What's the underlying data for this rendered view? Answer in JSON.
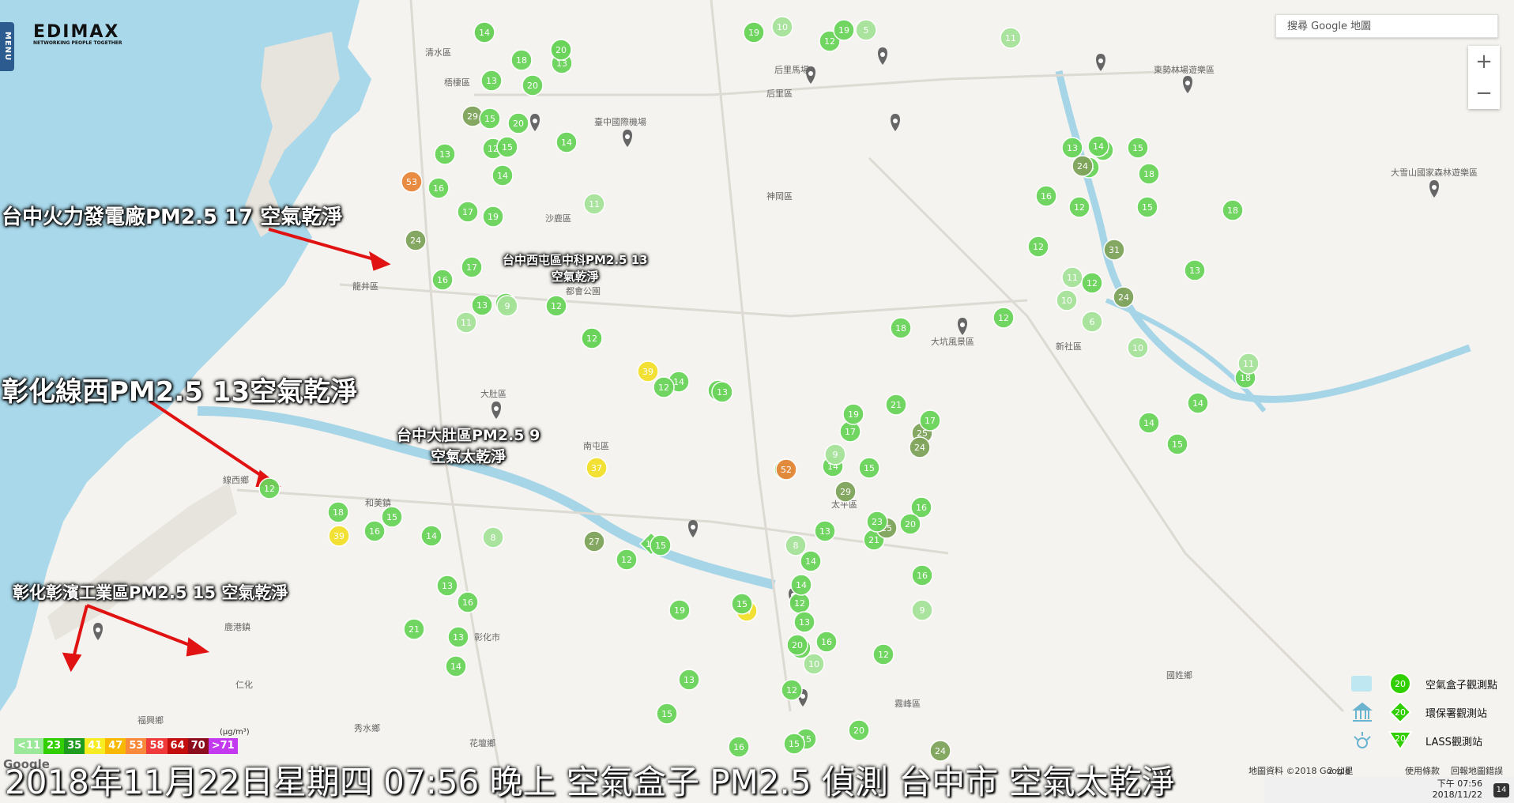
{
  "header": {
    "menu_label": "MENU",
    "brand": "EDIMAX",
    "tagline": "NETWORKING PEOPLE TOGETHER",
    "search_placeholder": "搜尋 Google 地圖"
  },
  "zoom": {
    "in_label": "+",
    "out_label": "−"
  },
  "callouts": [
    {
      "text": "台中火力發電廠PM2.5 17 空氣乾淨",
      "size": "large"
    },
    {
      "text": "台中西屯區中科PM2.5 13",
      "text2": "空氣乾淨",
      "size": "small"
    },
    {
      "text": "彰化線西PM2.5 13空氣乾淨",
      "size": "xl"
    },
    {
      "text": "台中大肚區PM2.5 9",
      "text2": "空氣太乾淨",
      "size": "medium"
    },
    {
      "text": "彰化彰濱工業區PM2.5 15 空氣乾淨",
      "size": "medium"
    }
  ],
  "place_names": [
    "清水區",
    "沙鹿區",
    "龍井區",
    "大肚區",
    "梧棲區",
    "臺中國際機場",
    "后里區",
    "后里馬場",
    "東勢林場遊樂區",
    "大雪山國家森林遊樂區",
    "大坑風景區",
    "新社區",
    "和美鎮",
    "線西鄉",
    "鹿港鎮",
    "福興鄉",
    "秀水鄉",
    "花壇鄉",
    "彰化市",
    "霧峰區",
    "太平區",
    "南屯區",
    "國姓鄉",
    "都會公園",
    "神岡區",
    "仁化"
  ],
  "legend": {
    "items": [
      {
        "label": "空氣盒子觀測點",
        "value": "20",
        "marker": "circle"
      },
      {
        "label": "環保署觀測站",
        "value": "20",
        "marker": "diamond"
      },
      {
        "label": "LASS觀測站",
        "value": "20",
        "marker": "triangle"
      }
    ]
  },
  "pm_scale": {
    "unit": "(μg/m³)",
    "bins": [
      {
        "label": "<11",
        "color": "#9be89b"
      },
      {
        "label": "23",
        "color": "#31cf00"
      },
      {
        "label": "35",
        "color": "#1f9b1f"
      },
      {
        "label": "41",
        "color": "#f7ec22"
      },
      {
        "label": "47",
        "color": "#f9b800"
      },
      {
        "label": "53",
        "color": "#f98a3b"
      },
      {
        "label": "58",
        "color": "#ef3b3b"
      },
      {
        "label": "64",
        "color": "#c40d0d"
      },
      {
        "label": "70",
        "color": "#8b0d1e"
      },
      {
        "label": ">71",
        "color": "#c339ef"
      }
    ]
  },
  "caption": "2018年11月22日星期四 07:56 晚上 空氣盒子 PM2.5 偵測 台中市 空氣太乾淨",
  "attribution": {
    "map_data": "地圖資料 ©2018 Google",
    "scale": "2 公里",
    "terms": "使用條款",
    "report": "回報地圖錯誤",
    "google": "Google"
  },
  "taskbar": {
    "time": "下午 07:56",
    "date": "2018/11/22",
    "badge": "14"
  },
  "colors": {
    "sea": "#a8d8ea",
    "land": "#f4f3ef",
    "river": "#a5d5e6",
    "marker_light": "#a6e39a",
    "marker_mid": "#6ad45a",
    "marker_dark": "#4aa83a",
    "marker_olive": "#7fa35a",
    "marker_orange": "#e8873a",
    "marker_yellow": "#f2df2c"
  },
  "markers": [
    {
      "v": 35,
      "s": "circle",
      "c": "olive"
    },
    {
      "v": 13,
      "s": "circle",
      "c": "mid"
    },
    {
      "v": 9,
      "s": "circle",
      "c": "light"
    },
    {
      "v": 10,
      "s": "circle",
      "c": "light"
    },
    {
      "v": 12,
      "s": "circle",
      "c": "mid"
    },
    {
      "v": 19,
      "s": "circle",
      "c": "mid"
    },
    {
      "v": 5,
      "s": "circle",
      "c": "light"
    },
    {
      "v": 11,
      "s": "circle",
      "c": "light"
    },
    {
      "v": 13,
      "s": "circle",
      "c": "mid"
    },
    {
      "v": 18,
      "s": "circle",
      "c": "mid"
    },
    {
      "v": 20,
      "s": "circle",
      "c": "mid"
    },
    {
      "v": 13,
      "s": "circle",
      "c": "mid"
    },
    {
      "v": 29,
      "s": "circle",
      "c": "olive"
    },
    {
      "v": 15,
      "s": "circle",
      "c": "mid"
    },
    {
      "v": 20,
      "s": "circle",
      "c": "mid"
    },
    {
      "v": 12,
      "s": "circle",
      "c": "mid"
    },
    {
      "v": 15,
      "s": "circle",
      "c": "mid"
    },
    {
      "v": 14,
      "s": "circle",
      "c": "mid"
    },
    {
      "v": 13,
      "s": "circle",
      "c": "mid"
    },
    {
      "v": 14,
      "s": "circle",
      "c": "mid"
    },
    {
      "v": 53,
      "s": "circle",
      "c": "orange"
    },
    {
      "v": 16,
      "s": "circle",
      "c": "mid"
    },
    {
      "v": 17,
      "s": "circle",
      "c": "mid"
    },
    {
      "v": 19,
      "s": "circle",
      "c": "mid"
    },
    {
      "v": 11,
      "s": "circle",
      "c": "light"
    },
    {
      "v": 24,
      "s": "circle",
      "c": "olive"
    },
    {
      "v": 17,
      "s": "circle",
      "c": "mid"
    },
    {
      "v": 13,
      "s": "circle",
      "c": "mid"
    },
    {
      "v": 16,
      "s": "circle",
      "c": "mid"
    },
    {
      "v": 13,
      "s": "circle",
      "c": "mid"
    },
    {
      "v": 9,
      "s": "circle",
      "c": "light"
    },
    {
      "v": 12,
      "s": "circle",
      "c": "mid"
    },
    {
      "v": 11,
      "s": "circle",
      "c": "light"
    },
    {
      "v": 13,
      "s": "circle",
      "c": "mid"
    },
    {
      "v": 12,
      "s": "circle",
      "c": "mid"
    },
    {
      "v": 14,
      "s": "circle",
      "c": "mid"
    },
    {
      "v": 17,
      "s": "circle",
      "c": "mid"
    },
    {
      "v": 39,
      "s": "circle",
      "c": "yellow"
    },
    {
      "v": 12,
      "s": "circle",
      "c": "mid"
    },
    {
      "v": 13,
      "s": "circle",
      "c": "mid"
    },
    {
      "v": 22,
      "s": "circle",
      "c": "mid"
    },
    {
      "v": 37,
      "s": "circle",
      "c": "yellow"
    },
    {
      "v": 52,
      "s": "circle",
      "c": "orange"
    },
    {
      "v": 14,
      "s": "circle",
      "c": "mid"
    },
    {
      "v": 15,
      "s": "circle",
      "c": "mid"
    },
    {
      "v": 12,
      "s": "circle",
      "c": "mid"
    },
    {
      "v": 18,
      "s": "circle",
      "c": "mid"
    },
    {
      "v": 15,
      "s": "circle",
      "c": "mid"
    },
    {
      "v": 39,
      "s": "circle",
      "c": "yellow"
    },
    {
      "v": 16,
      "s": "circle",
      "c": "mid"
    },
    {
      "v": 14,
      "s": "circle",
      "c": "mid"
    },
    {
      "v": 8,
      "s": "circle",
      "c": "light"
    },
    {
      "v": 12,
      "s": "circle",
      "c": "mid"
    },
    {
      "v": 13,
      "s": "diamond",
      "c": "mid"
    },
    {
      "v": 27,
      "s": "circle",
      "c": "olive"
    },
    {
      "v": 15,
      "s": "circle",
      "c": "mid"
    },
    {
      "v": 8,
      "s": "circle",
      "c": "light"
    },
    {
      "v": 14,
      "s": "circle",
      "c": "mid"
    },
    {
      "v": 12,
      "s": "circle",
      "c": "mid"
    },
    {
      "v": 13,
      "s": "circle",
      "c": "mid"
    },
    {
      "v": 19,
      "s": "circle",
      "c": "mid"
    },
    {
      "v": 37,
      "s": "circle",
      "c": "yellow"
    },
    {
      "v": 13,
      "s": "circle",
      "c": "mid"
    },
    {
      "v": 21,
      "s": "circle",
      "c": "mid"
    },
    {
      "v": 25,
      "s": "circle",
      "c": "olive"
    },
    {
      "v": 10,
      "s": "circle",
      "c": "light"
    },
    {
      "v": 16,
      "s": "circle",
      "c": "mid"
    },
    {
      "v": 12,
      "s": "circle",
      "c": "mid"
    },
    {
      "v": 13,
      "s": "circle",
      "c": "mid"
    },
    {
      "v": 15,
      "s": "circle",
      "c": "mid"
    },
    {
      "v": 15,
      "s": "circle",
      "c": "mid"
    },
    {
      "v": 20,
      "s": "circle",
      "c": "mid"
    },
    {
      "v": 16,
      "s": "circle",
      "c": "mid"
    },
    {
      "v": 15,
      "s": "circle",
      "c": "mid"
    },
    {
      "v": 12,
      "s": "circle",
      "c": "mid"
    },
    {
      "v": 9,
      "s": "circle",
      "c": "light"
    },
    {
      "v": 13,
      "s": "circle",
      "c": "mid"
    },
    {
      "v": 15,
      "s": "circle",
      "c": "mid"
    },
    {
      "v": 14,
      "s": "circle",
      "c": "mid"
    },
    {
      "v": 13,
      "s": "circle",
      "c": "mid"
    },
    {
      "v": 21,
      "s": "circle",
      "c": "mid"
    },
    {
      "v": 16,
      "s": "circle",
      "c": "mid"
    },
    {
      "v": 13,
      "s": "circle",
      "c": "mid"
    },
    {
      "v": 14,
      "s": "circle",
      "c": "mid"
    },
    {
      "v": 16,
      "s": "circle",
      "c": "mid"
    },
    {
      "v": 25,
      "s": "circle",
      "c": "olive"
    },
    {
      "v": 24,
      "s": "circle",
      "c": "olive"
    },
    {
      "v": 21,
      "s": "circle",
      "c": "mid"
    },
    {
      "v": 23,
      "s": "circle",
      "c": "mid"
    },
    {
      "v": 17,
      "s": "circle",
      "c": "mid"
    },
    {
      "v": 9,
      "s": "circle",
      "c": "light"
    },
    {
      "v": 19,
      "s": "circle",
      "c": "mid"
    },
    {
      "v": 20,
      "s": "circle",
      "c": "mid"
    },
    {
      "v": 16,
      "s": "circle",
      "c": "mid"
    },
    {
      "v": 20,
      "s": "circle",
      "c": "mid"
    },
    {
      "v": 29,
      "s": "circle",
      "c": "olive"
    },
    {
      "v": 24,
      "s": "circle",
      "c": "olive"
    },
    {
      "v": 18,
      "s": "circle",
      "c": "mid"
    },
    {
      "v": 13,
      "s": "circle",
      "c": "mid"
    },
    {
      "v": 21,
      "s": "circle",
      "c": "mid"
    },
    {
      "v": 14,
      "s": "circle",
      "c": "mid"
    },
    {
      "v": 12,
      "s": "circle",
      "c": "mid"
    },
    {
      "v": 11,
      "s": "circle",
      "c": "light"
    },
    {
      "v": 6,
      "s": "circle",
      "c": "light"
    },
    {
      "v": 12,
      "s": "circle",
      "c": "mid"
    },
    {
      "v": 10,
      "s": "circle",
      "c": "light"
    },
    {
      "v": 24,
      "s": "circle",
      "c": "olive"
    },
    {
      "v": 14,
      "s": "circle",
      "c": "mid"
    },
    {
      "v": 16,
      "s": "circle",
      "c": "mid"
    },
    {
      "v": 15,
      "s": "circle",
      "c": "mid"
    },
    {
      "v": 18,
      "s": "circle",
      "c": "mid"
    },
    {
      "v": 12,
      "s": "circle",
      "c": "mid"
    },
    {
      "v": 10,
      "s": "circle",
      "c": "light"
    },
    {
      "v": 18,
      "s": "circle",
      "c": "mid"
    },
    {
      "v": 24,
      "s": "circle",
      "c": "olive"
    },
    {
      "v": 31,
      "s": "circle",
      "c": "olive"
    },
    {
      "v": 14,
      "s": "circle",
      "c": "mid"
    },
    {
      "v": 18,
      "s": "circle",
      "c": "mid"
    },
    {
      "v": 11,
      "s": "circle",
      "c": "light"
    },
    {
      "v": 14,
      "s": "circle",
      "c": "mid"
    },
    {
      "v": 15,
      "s": "circle",
      "c": "mid"
    },
    {
      "v": 15,
      "s": "circle",
      "c": "mid"
    },
    {
      "v": 13,
      "s": "circle",
      "c": "mid"
    },
    {
      "v": 12,
      "s": "circle",
      "c": "mid"
    },
    {
      "v": 17,
      "s": "circle",
      "c": "mid"
    },
    {
      "v": 14,
      "s": "circle",
      "c": "mid"
    },
    {
      "v": 20,
      "s": "circle",
      "c": "mid"
    },
    {
      "v": 19,
      "s": "circle",
      "c": "mid"
    }
  ]
}
